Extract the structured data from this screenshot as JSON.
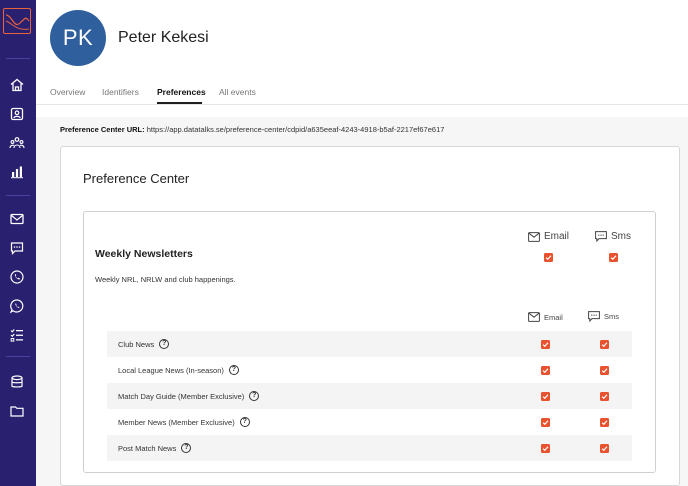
{
  "sidebar": {
    "icons": [
      "logo-icon",
      "home-icon",
      "contact-card-icon",
      "people-icon",
      "bar-chart-icon",
      "mail-icon",
      "chat-icon",
      "phone-icon",
      "whatsapp-icon",
      "checklist-icon",
      "database-icon",
      "folder-icon"
    ]
  },
  "profile": {
    "initials": "PK",
    "name": "Peter Kekesi",
    "avatar_color": "#2f5f9d"
  },
  "tabs": [
    {
      "label": "Overview",
      "active": false
    },
    {
      "label": "Identifiers",
      "active": false
    },
    {
      "label": "Preferences",
      "active": true
    },
    {
      "label": "All events",
      "active": false
    }
  ],
  "preference_url": {
    "label": "Preference Center URL:",
    "value": "https://app.datatalks.se/preference-center/cdpid/a635eeaf-4243-4918-b5af-2217ef67e617"
  },
  "preference_center": {
    "title": "Preference Center",
    "group": {
      "title": "Weekly Newsletters",
      "description": "Weekly NRL, NRLW and club happenings.",
      "channels": [
        "Email",
        "Sms"
      ],
      "email_checked": true,
      "sms_checked": true,
      "sub_channels": [
        "Email",
        "Sms"
      ],
      "items": [
        {
          "label": "Club News",
          "email": true,
          "sms": true
        },
        {
          "label": "Local League News (In-season)",
          "email": true,
          "sms": true
        },
        {
          "label": "Match Day Guide (Member Exclusive)",
          "email": true,
          "sms": true
        },
        {
          "label": "Member News (Member Exclusive)",
          "email": true,
          "sms": true
        },
        {
          "label": "Post Match News",
          "email": true,
          "sms": true
        }
      ]
    }
  },
  "colors": {
    "sidebar": "#2a2070",
    "accent": "#e8522f",
    "checkbox": "#e8522f"
  }
}
